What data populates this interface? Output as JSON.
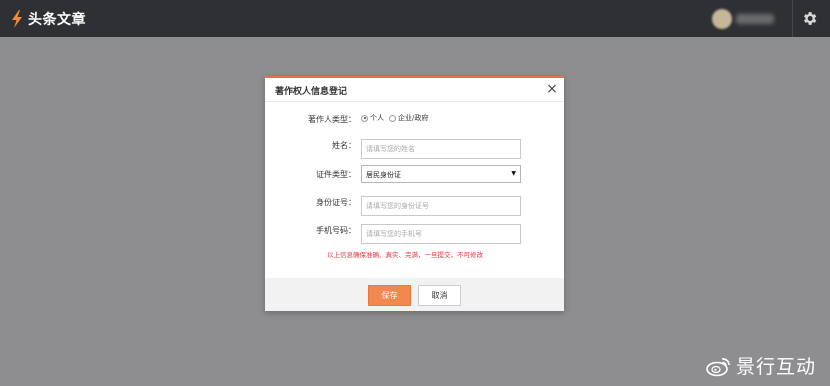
{
  "app": {
    "title": "头条文章"
  },
  "dialog": {
    "title": "著作权人信息登记",
    "close_glyph": "×",
    "author_type": {
      "label": "著作人类型：",
      "options": [
        "个人",
        "企业/政府"
      ],
      "selected": "个人"
    },
    "name": {
      "label": "姓名：",
      "placeholder": "请填写您的姓名"
    },
    "id_type": {
      "label": "证件类型：",
      "value": "居民身份证"
    },
    "id_number": {
      "label": "身份证号：",
      "placeholder": "请填写您的身份证号"
    },
    "phone": {
      "label": "手机号码：",
      "placeholder": "请填写您的手机号"
    },
    "warning": "以上信息确保准确、真实、完满，一旦提交，不可修改",
    "save_label": "保存",
    "cancel_label": "取消"
  },
  "watermark": {
    "text": "景行互动"
  },
  "colors": {
    "accent": "#f26d3d",
    "save_button": "#f0884f",
    "warning": "#e5353a",
    "topbar": "#2f3033",
    "backdrop": "#8e8e90"
  },
  "icons": {
    "logo": "lightning-bolt-icon",
    "settings": "gear-icon",
    "close": "close-icon",
    "dropdown": "triangle-down-icon",
    "watermark": "weibo-icon"
  }
}
